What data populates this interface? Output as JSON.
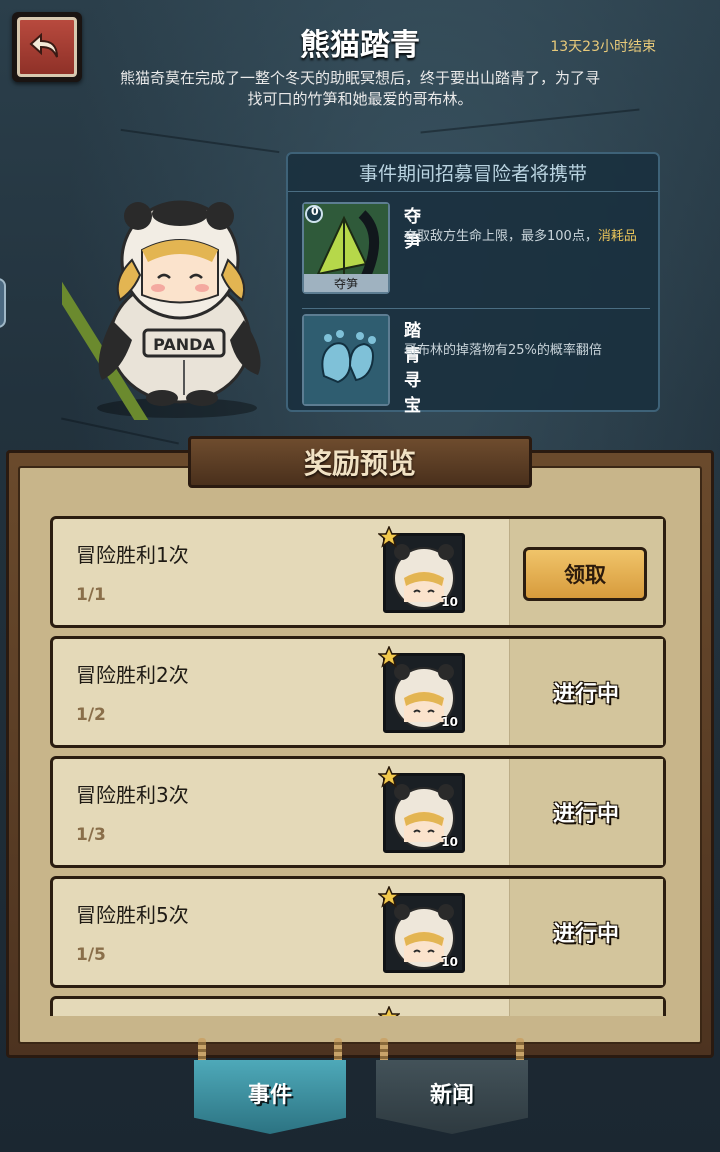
{
  "header": {
    "title": "熊猫踏青",
    "timer": "13天23小时结束",
    "description": "熊猫奇莫在完成了一整个冬天的助眠冥想后，终于要出山踏青了，为了寻找可口的竹笋和她最爱的哥布林。"
  },
  "info_panel": {
    "heading": "事件期间招募冒险者将携带",
    "skills": [
      {
        "name": "夺笋",
        "card_label": "夺笋",
        "card_cost": "0",
        "text_main": "夺取敌方生命上限，最多100点，",
        "text_highlight": "消耗品"
      },
      {
        "name": "踏青寻宝",
        "text_main": "哥布林的掉落物有25%的概率翻倍"
      }
    ]
  },
  "rewards": {
    "title": "奖励预览",
    "rows": [
      {
        "label": "冒险胜利1次",
        "progress": "1/1",
        "reward_count": "10",
        "status": "领取",
        "claimable": true
      },
      {
        "label": "冒险胜利2次",
        "progress": "1/2",
        "reward_count": "10",
        "status": "进行中",
        "claimable": false
      },
      {
        "label": "冒险胜利3次",
        "progress": "1/3",
        "reward_count": "10",
        "status": "进行中",
        "claimable": false
      },
      {
        "label": "冒险胜利5次",
        "progress": "1/5",
        "reward_count": "10",
        "status": "进行中",
        "claimable": false
      }
    ]
  },
  "tabs": [
    {
      "label": "事件",
      "active": true
    },
    {
      "label": "新闻",
      "active": false
    }
  ],
  "colors": {
    "accent_gold": "#e9c45a",
    "claim_button": "#e8b557",
    "active_tab": "#3d8e9d",
    "back_button": "#a53e33"
  },
  "icons": [
    "back-arrow-icon",
    "bamboo-shoot-card-icon",
    "footprint-icon",
    "star-badge-icon",
    "panda-hero-portrait"
  ]
}
